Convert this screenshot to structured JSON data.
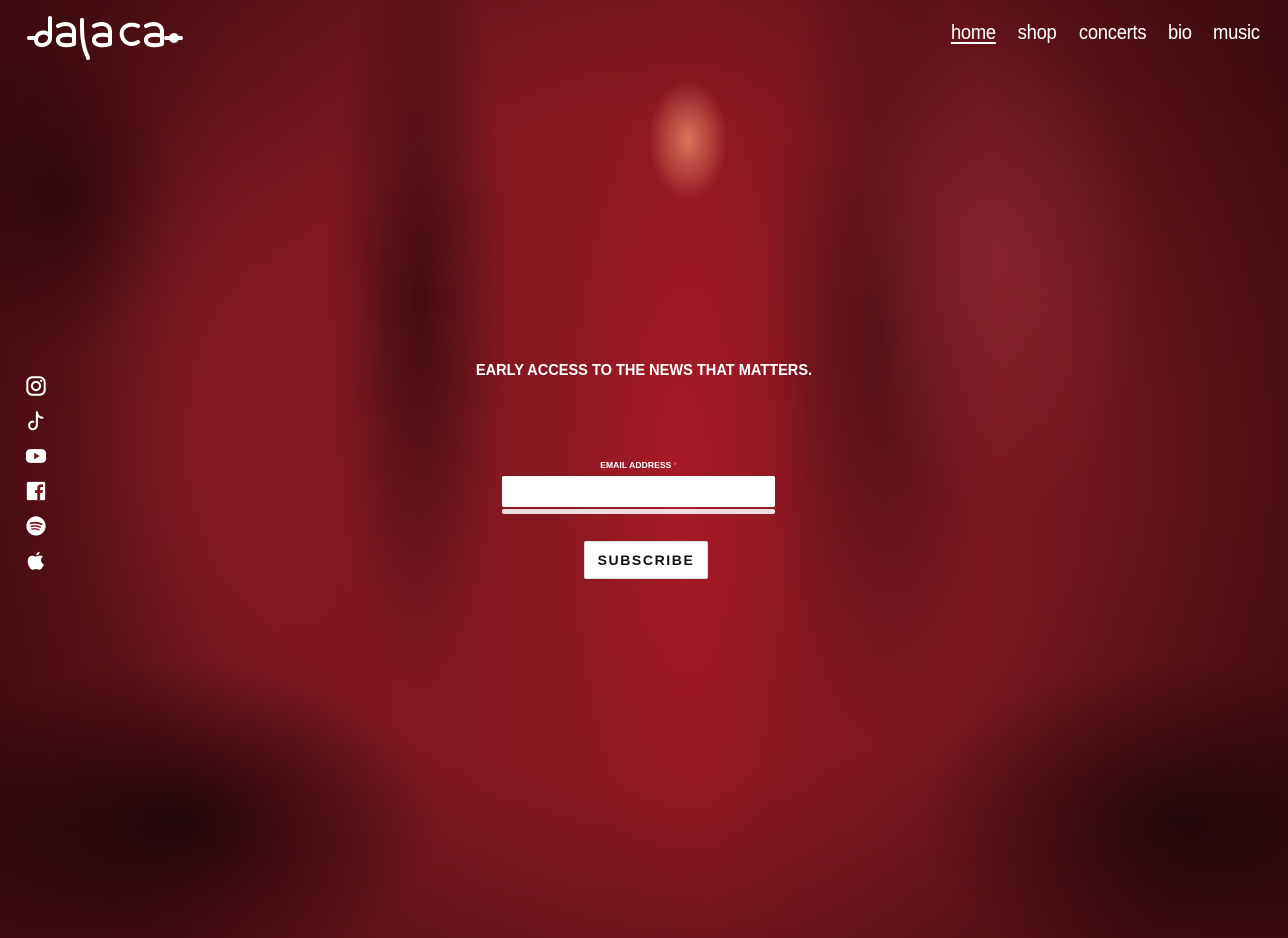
{
  "site": {
    "logo_text": "dalaca"
  },
  "nav": {
    "items": [
      {
        "label": "home",
        "active": true
      },
      {
        "label": "shop",
        "active": false
      },
      {
        "label": "concerts",
        "active": false
      },
      {
        "label": "bio",
        "active": false
      },
      {
        "label": "music",
        "active": false
      }
    ]
  },
  "social": {
    "icons": [
      "instagram-icon",
      "tiktok-icon",
      "youtube-icon",
      "facebook-icon",
      "spotify-icon",
      "apple-icon"
    ]
  },
  "signup": {
    "headline": "EARLY ACCESS TO THE NEWS THAT MATTERS.",
    "email_label": "EMAIL ADDRESS",
    "required_marker": "*",
    "email_value": "",
    "button_label": "SUBSCRIBE"
  },
  "colors": {
    "text": "#ffffff",
    "required": "#e2554f",
    "background_red": "#8e1823",
    "button_bg": "#ffffff",
    "button_text": "#111111"
  }
}
